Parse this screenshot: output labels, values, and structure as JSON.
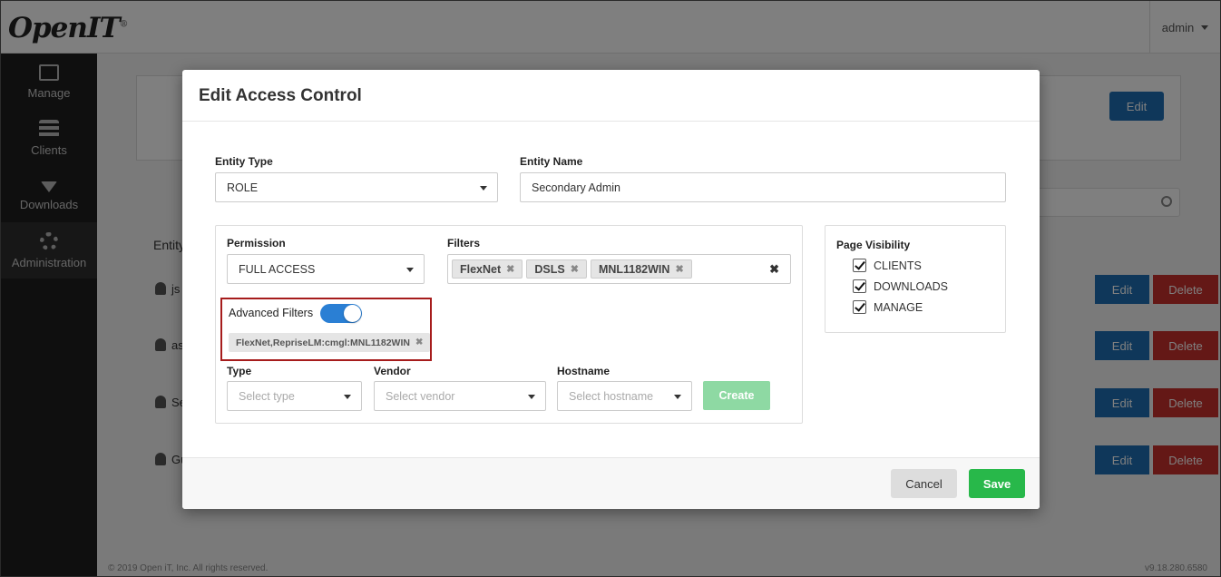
{
  "app": {
    "logo": "OpenIT",
    "logo_mark": "®",
    "user": "admin",
    "sidebar": [
      {
        "label": "Manage",
        "icon": "id-card-icon"
      },
      {
        "label": "Clients",
        "icon": "server-icon"
      },
      {
        "label": "Downloads",
        "icon": "download-icon"
      },
      {
        "label": "Administration",
        "icon": "gears-icon"
      }
    ],
    "background": {
      "entity_header": "Entity",
      "rows": [
        "js",
        "as",
        "Se",
        "Gu"
      ],
      "edit_label": "Edit",
      "delete_label": "Delete"
    },
    "footer_left": "© 2019 Open iT, Inc. All rights reserved.",
    "footer_right": "v9.18.280.6580"
  },
  "modal": {
    "title": "Edit Access Control",
    "entity_type": {
      "label": "Entity Type",
      "value": "ROLE"
    },
    "entity_name": {
      "label": "Entity Name",
      "value": "Secondary Admin"
    },
    "permission": {
      "label": "Permission",
      "value": "FULL ACCESS"
    },
    "filters": {
      "label": "Filters",
      "tags": [
        "FlexNet",
        "DSLS",
        "MNL1182WIN"
      ]
    },
    "advanced_filters": {
      "label": "Advanced Filters",
      "enabled": true,
      "tag": "FlexNet,RepriseLM:cmgl:MNL1182WIN"
    },
    "type": {
      "label": "Type",
      "placeholder": "Select type"
    },
    "vendor": {
      "label": "Vendor",
      "placeholder": "Select vendor"
    },
    "hostname": {
      "label": "Hostname",
      "placeholder": "Select hostname"
    },
    "create_label": "Create",
    "page_visibility": {
      "label": "Page Visibility",
      "items": [
        {
          "label": "CLIENTS",
          "checked": true
        },
        {
          "label": "DOWNLOADS",
          "checked": true
        },
        {
          "label": "MANAGE",
          "checked": true
        }
      ]
    },
    "cancel_label": "Cancel",
    "save_label": "Save"
  },
  "colors": {
    "primary": "#1f6fb4",
    "danger": "#c9302c",
    "success": "#28b84a",
    "toggle": "#2a7fd4",
    "highlight": "#a61c1c"
  }
}
